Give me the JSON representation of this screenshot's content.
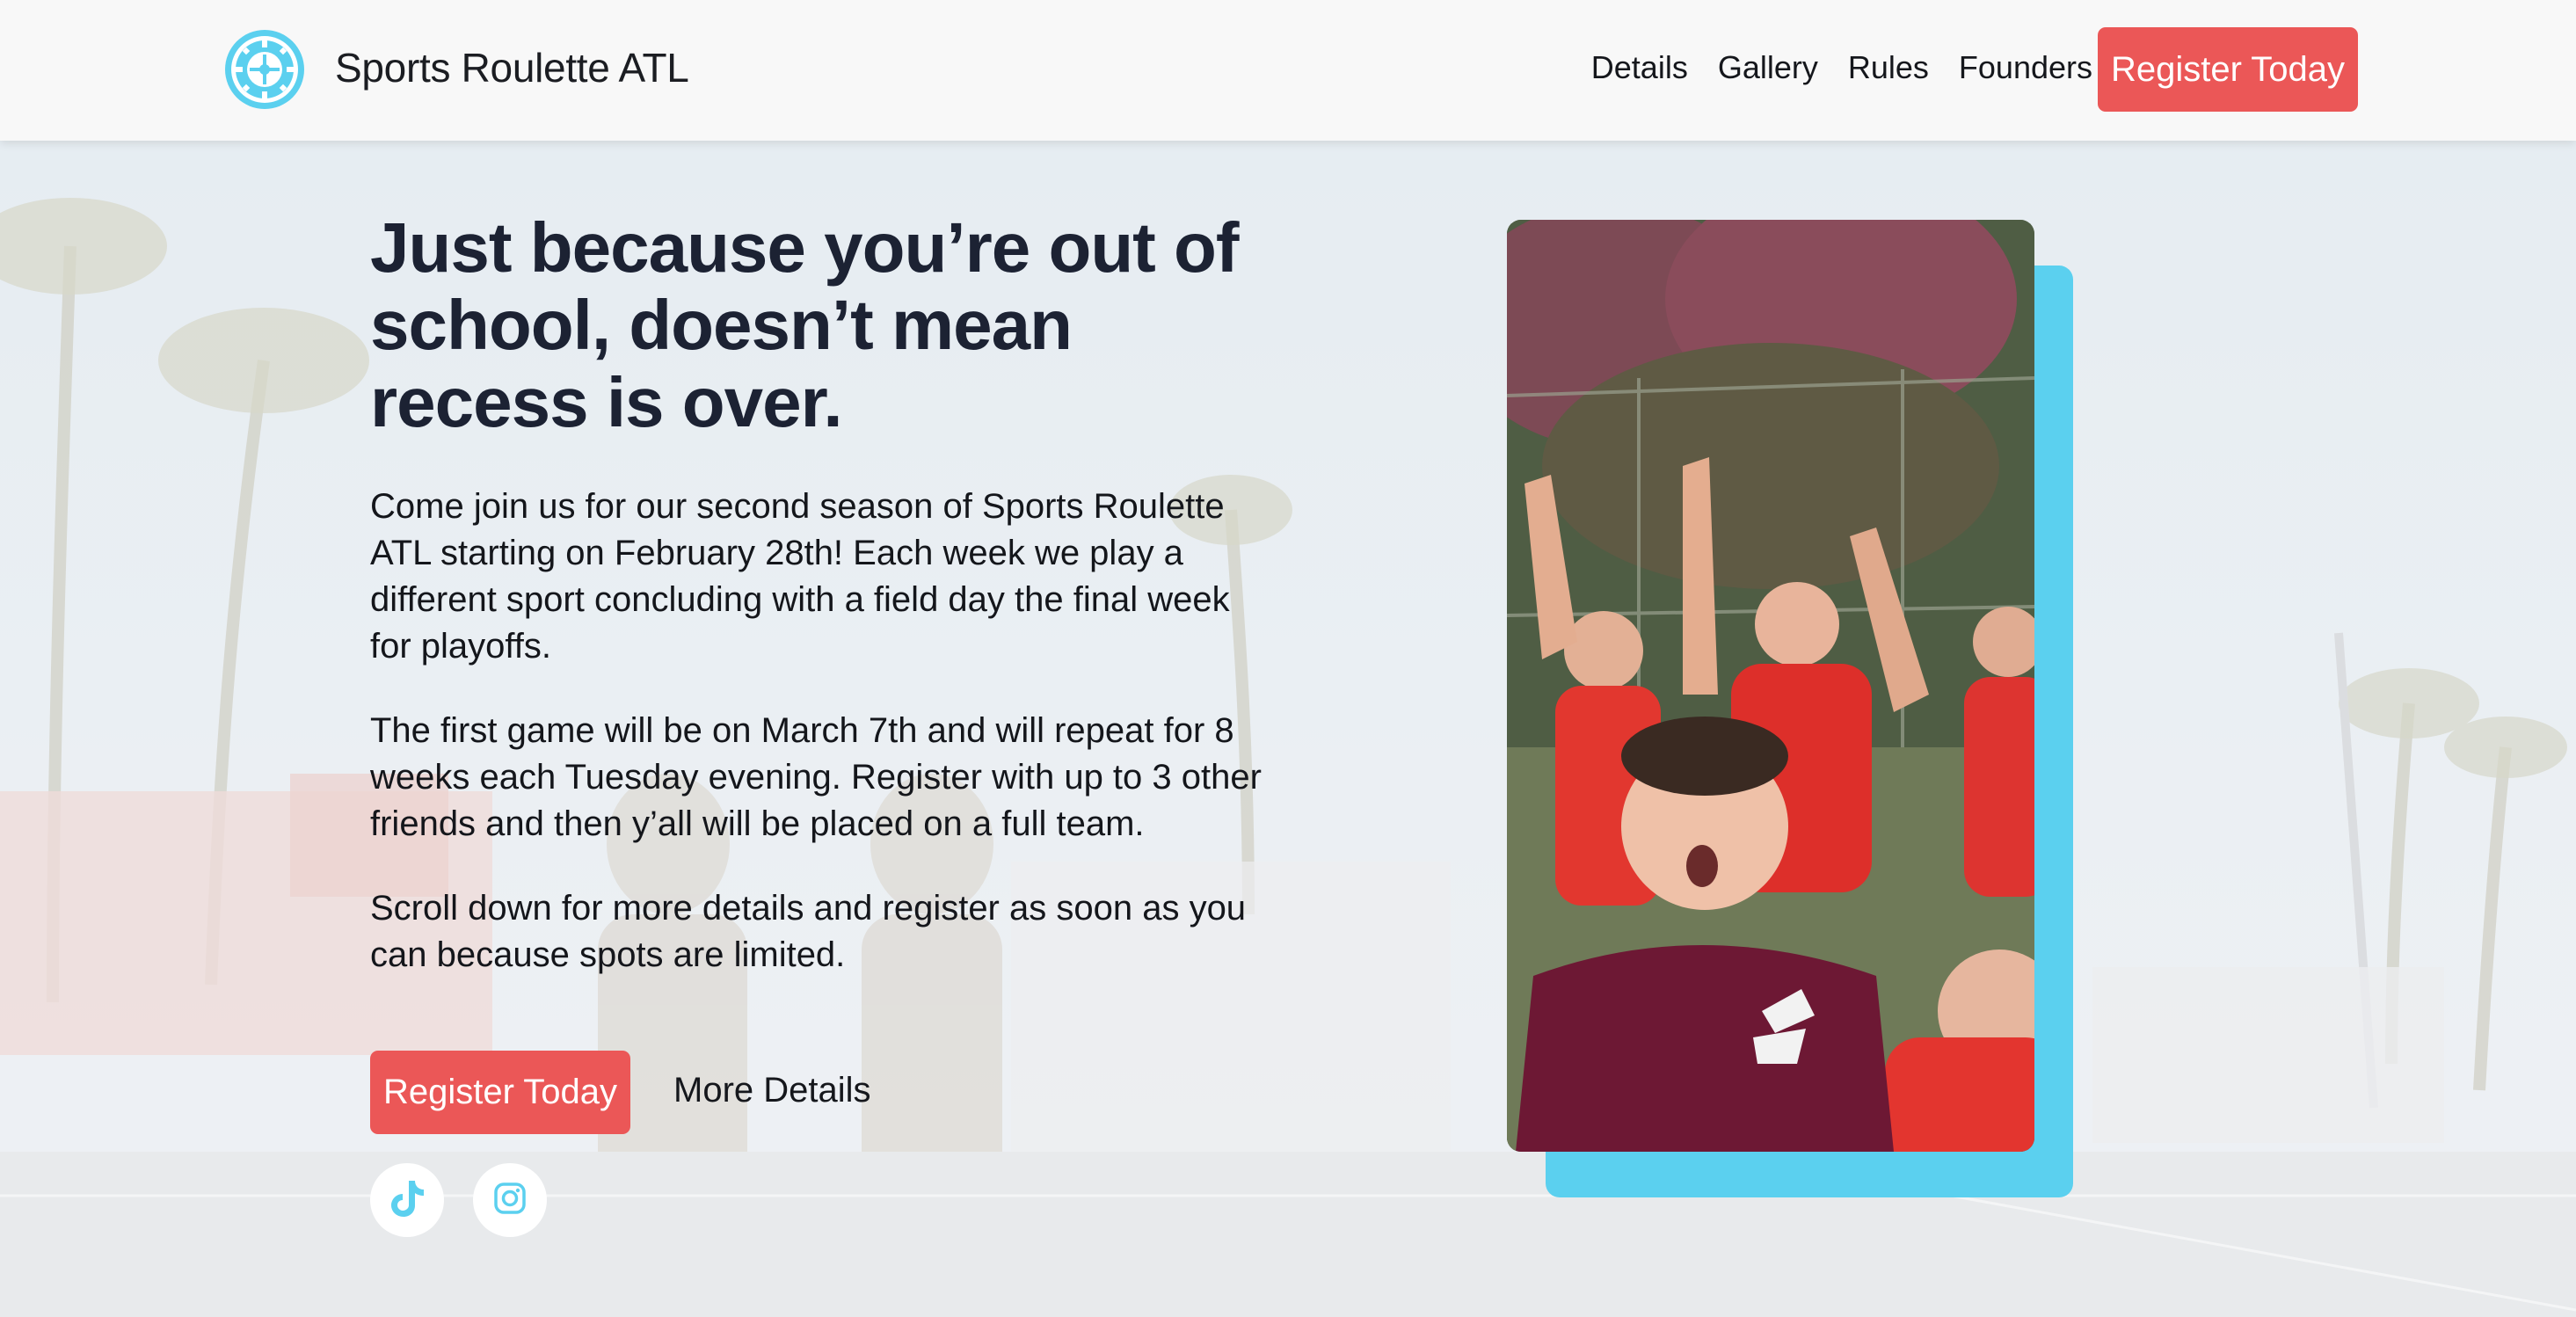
{
  "header": {
    "brand": "Sports Roulette ATL",
    "logo_icon": "roulette-wheel-icon",
    "nav": [
      {
        "label": "Details"
      },
      {
        "label": "Gallery"
      },
      {
        "label": "Rules"
      },
      {
        "label": "Founders"
      }
    ],
    "cta_label": "Register Today"
  },
  "hero": {
    "title": "Just because you’re out of school, doesn’t mean recess is over.",
    "paragraphs": [
      "Come join us for our second season of Sports Roulette ATL starting on February 28th! Each week we play a different sport concluding with a field day the final week for playoffs.",
      "The first game will be on March 7th and will repeat for 8 weeks each Tuesday evening. Register with up to 3 other friends and then y’all will be placed on a full team.",
      "Scroll down for more details and register as soon as you can because spots are limited."
    ],
    "primary_button": "Register Today",
    "secondary_button": "More Details",
    "socials": [
      {
        "icon": "tiktok-icon"
      },
      {
        "icon": "instagram-icon"
      }
    ]
  },
  "colors": {
    "accent": "#eb5757",
    "card_accent": "#5bd0ef",
    "heading": "#1c2233",
    "navbar_bg": "#f8f8f8"
  }
}
